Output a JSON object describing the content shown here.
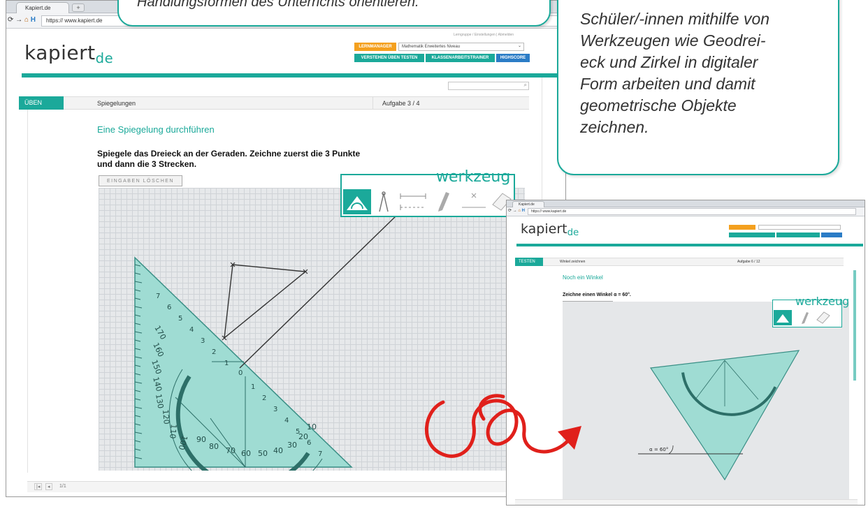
{
  "bubble_left": {
    "text": "Handlungsformen des Unterrichts orientieren."
  },
  "bubble_right": {
    "lines": [
      "Schüler/-innen mithilfe von",
      "Werkzeugen wie Geodrei-",
      "eck und Zirkel in digitaler",
      "Form arbeiten und damit",
      "geometrische Objekte",
      "zeichnen."
    ]
  },
  "window_large": {
    "tab_title": "Kapiert.de",
    "url": "https:// www.kapiert.de",
    "logo": {
      "main": "kapiert",
      "suffix": "de"
    },
    "header": {
      "lernmanager": "LERNMANAGER",
      "level_select": "Mathematik Erweitertes Niveau",
      "top_links": "Lerngruppe / Einstellungen  |  Abmelden",
      "nav": [
        "VERSTEHEN ÜBEN TESTEN",
        "KLASSENARBEITSTRAINER",
        "HIGHSCORE"
      ]
    },
    "mode": "ÜBEN",
    "topic": "Spiegelungen",
    "task_counter": "Aufgabe 3 / 4",
    "task_title": "Eine Spiegelung durchführen",
    "task_text_lines": [
      "Spiegele das Dreieck an der Geraden. Zeichne zuerst die 3 Punkte",
      "und dann die 3 Strecken."
    ],
    "clear_button": "EINGABEN LÖSCHEN",
    "toolbox_title": "werkzeug",
    "tools": [
      "geodreieck-icon",
      "zirkel-icon",
      "strecke-icon",
      "stift-icon",
      "punkt-icon",
      "radierer-icon"
    ],
    "protractor_numbers": [
      "170",
      "160",
      "150",
      "140",
      "130",
      "120",
      "110",
      "100",
      "90",
      "80",
      "70",
      "60",
      "50",
      "40",
      "30",
      "20",
      "10"
    ],
    "scale_numbers": [
      "7",
      "6",
      "5",
      "4",
      "3",
      "2",
      "1",
      "0",
      "1",
      "2",
      "3",
      "4",
      "5",
      "6",
      "7"
    ],
    "footer": "1/1"
  },
  "window_small": {
    "tab_title": "Kapiert.de",
    "url": "https:// www.kapiert.de",
    "logo": {
      "main": "kapiert",
      "suffix": "de"
    },
    "mode": "TESTEN",
    "topic": "Winkel zeichnen",
    "task_counter": "Aufgabe 6 / 12",
    "task_title": "Noch ein Winkel",
    "task_text": "Zeichne einen Winkel α = 60°.",
    "clear_button": "EINGABEN LÖSCHEN",
    "toolbox_title": "werkzeug",
    "angle_label": "α = 60°"
  },
  "colors": {
    "teal": "#1ba99a",
    "orange": "#f4a01e",
    "blue": "#2b7cc6",
    "arrow_red": "#e0201b",
    "geodreieck": "#9fdcd3"
  }
}
